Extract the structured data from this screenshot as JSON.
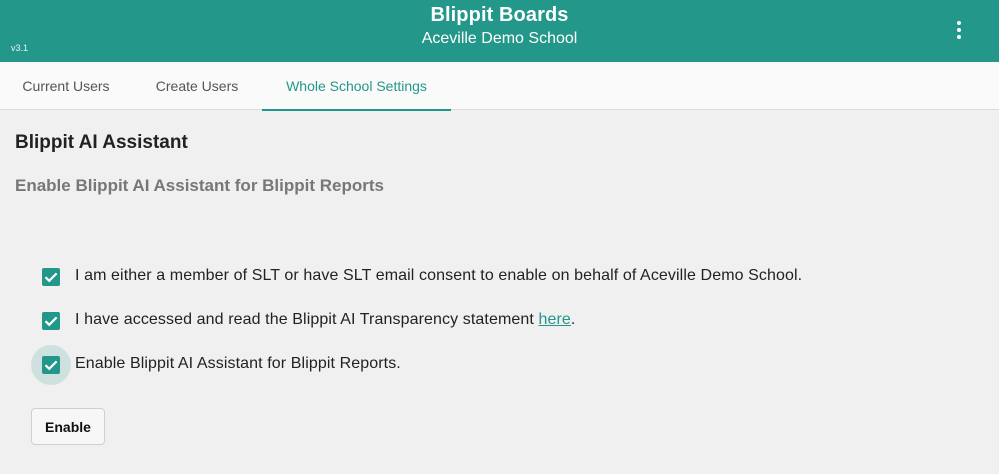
{
  "header": {
    "title": "Blippit Boards",
    "subtitle": "Aceville Demo School",
    "version": "v3.1",
    "bg_color": "#23978a"
  },
  "tabs": [
    {
      "label": "Current Users",
      "active": false
    },
    {
      "label": "Create Users",
      "active": false
    },
    {
      "label": "Whole School Settings",
      "active": true
    }
  ],
  "section": {
    "title": "Blippit AI Assistant",
    "subtitle": "Enable Blippit AI Assistant for Blippit Reports"
  },
  "options": [
    {
      "text": "I am either a member of SLT or have SLT email consent to enable on behalf of Aceville Demo School.",
      "checked": true
    },
    {
      "text_before": "I have accessed and read the Blippit AI Transparency statement ",
      "link": "here",
      "text_after": ".",
      "checked": true
    },
    {
      "text": "Enable Blippit AI Assistant for Blippit Reports.",
      "checked": true,
      "focused": true
    }
  ],
  "enable_button": {
    "label": "Enable"
  },
  "icons": {
    "menu": "more-vert-icon",
    "checkbox": "check-icon"
  }
}
